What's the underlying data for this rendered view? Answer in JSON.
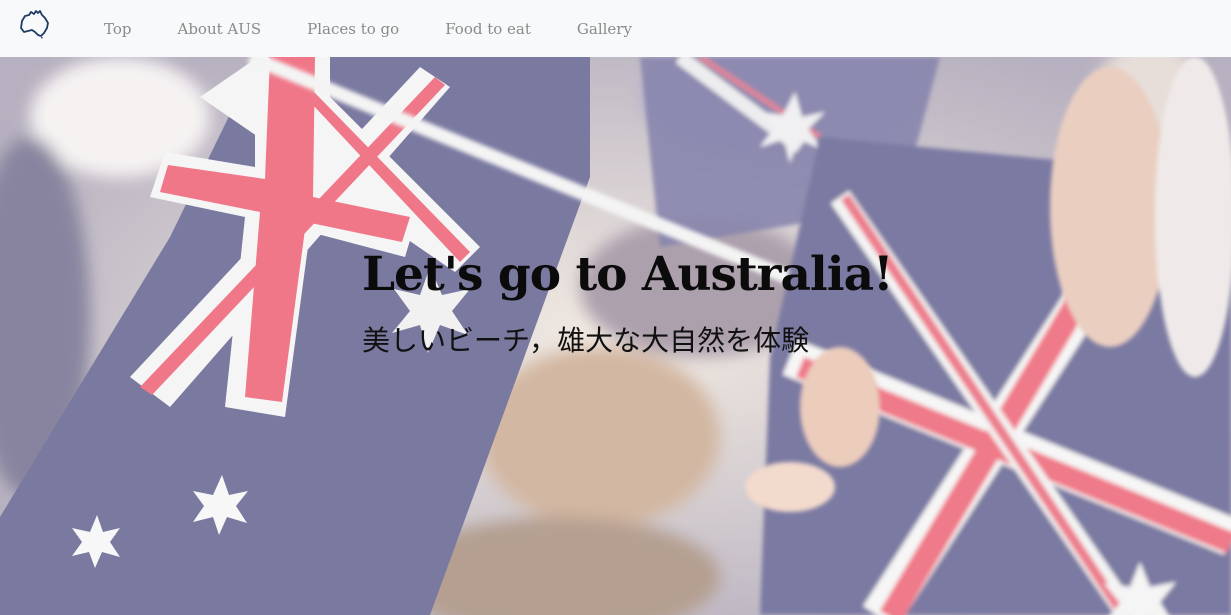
{
  "navbar": {
    "brand_icon": "australia-map-icon",
    "items": [
      {
        "label": "Top"
      },
      {
        "label": "About AUS"
      },
      {
        "label": "Places to go"
      },
      {
        "label": "Food to eat"
      },
      {
        "label": "Gallery"
      }
    ]
  },
  "hero": {
    "title": "Let's go to Australia!",
    "subtitle": "美しいビーチ，雄大な大自然を体験",
    "background": "australian-flags-photo"
  },
  "colors": {
    "navbar_bg": "#f8f9fa",
    "nav_link": "#8a8a8a",
    "flag_blue": "#5d5c8c",
    "flag_red": "#ec5a6e"
  }
}
